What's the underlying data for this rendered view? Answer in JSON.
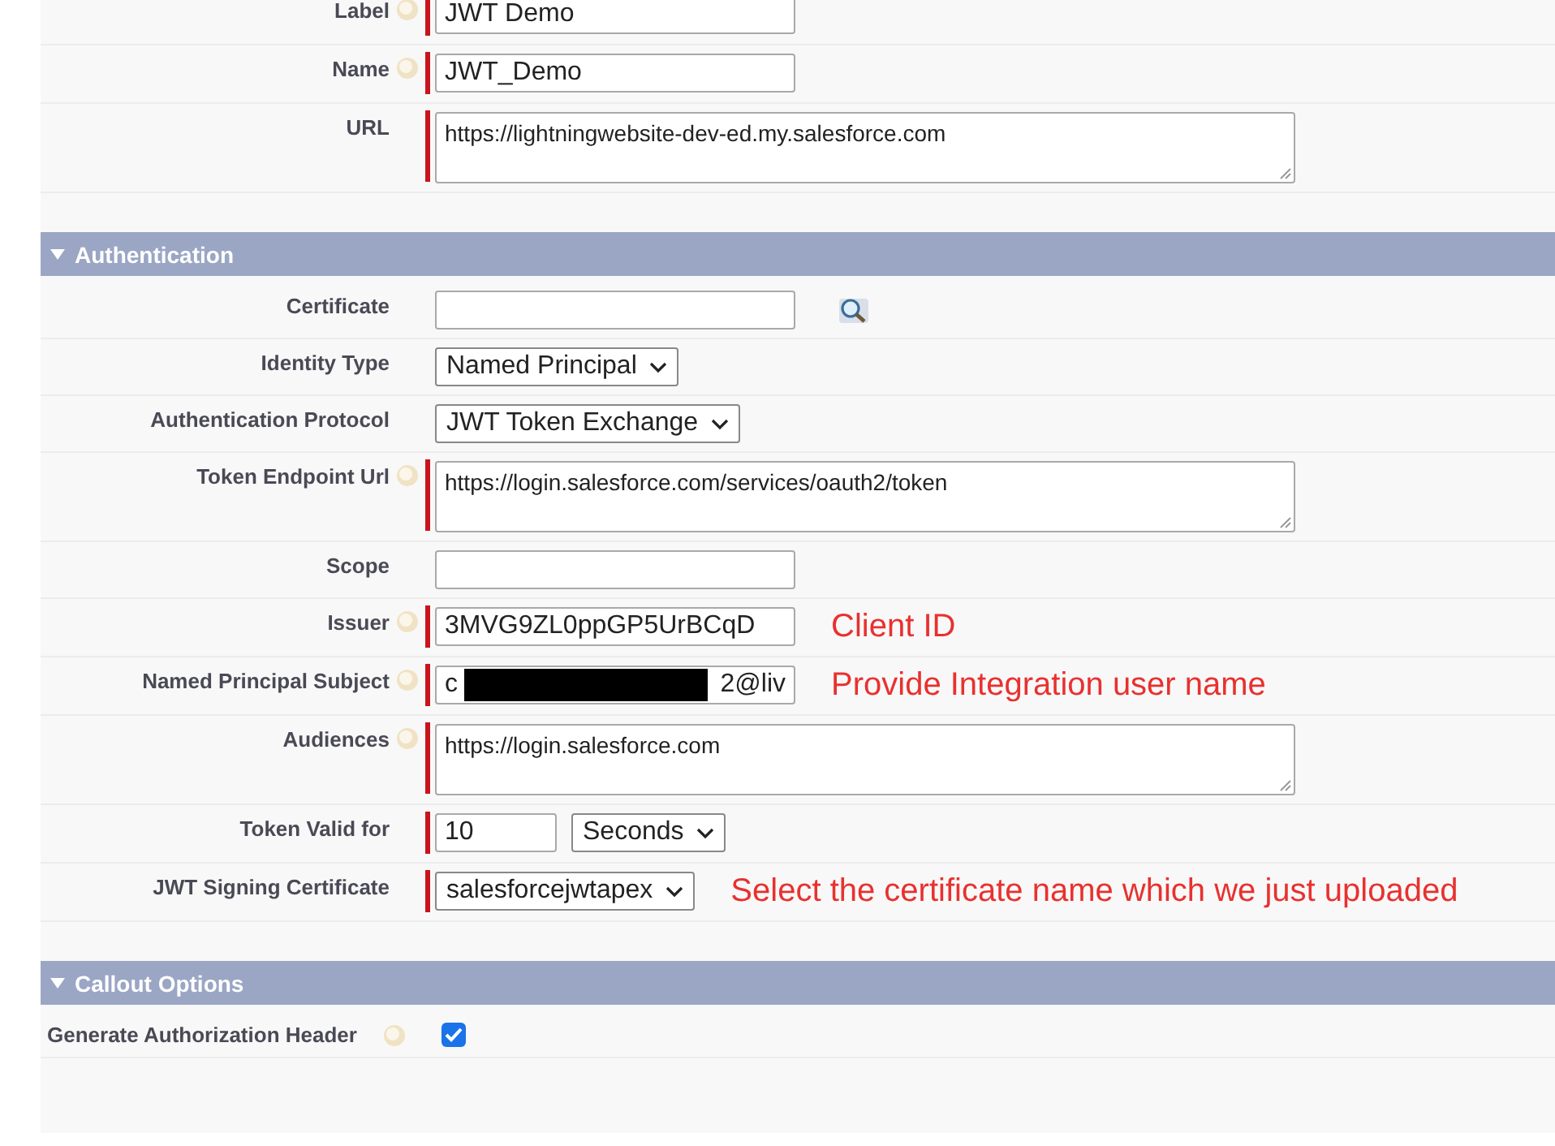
{
  "sections": [
    {
      "rows": [
        {
          "kind": "text",
          "label": "Label",
          "help": true,
          "required": true,
          "value": "JWT Demo"
        },
        {
          "kind": "text",
          "label": "Name",
          "help": true,
          "required": true,
          "value": "JWT_Demo"
        },
        {
          "kind": "textarea",
          "label": "URL",
          "help": false,
          "required": true,
          "value": "https://lightningwebsite-dev-ed.my.salesforce.com"
        }
      ]
    },
    {
      "title": "Authentication",
      "expanded": true,
      "rows": [
        {
          "kind": "lookup",
          "label": "Certificate",
          "help": false,
          "required": false,
          "value": ""
        },
        {
          "kind": "select",
          "label": "Identity Type",
          "help": false,
          "required": false,
          "value": "Named Principal"
        },
        {
          "kind": "select",
          "label": "Authentication Protocol",
          "help": false,
          "required": false,
          "value": "JWT Token Exchange"
        },
        {
          "kind": "textarea",
          "label": "Token Endpoint Url",
          "help": true,
          "required": true,
          "value": "https://login.salesforce.com/services/oauth2/token"
        },
        {
          "kind": "text",
          "label": "Scope",
          "help": false,
          "required": false,
          "value": ""
        },
        {
          "kind": "text",
          "label": "Issuer",
          "help": true,
          "required": true,
          "value": "3MVG9ZL0ppGP5UrBCqD",
          "note": "Client ID"
        },
        {
          "kind": "redacted",
          "label": "Named Principal Subject",
          "help": true,
          "required": true,
          "value_parts": [
            "c",
            "2@liv"
          ],
          "note": "Provide Integration user name"
        },
        {
          "kind": "textarea",
          "label": "Audiences",
          "help": true,
          "required": true,
          "value": "https://login.salesforce.com"
        },
        {
          "kind": "number_unit",
          "label": "Token Valid for",
          "help": false,
          "required": true,
          "value": "10",
          "unit": "Seconds"
        },
        {
          "kind": "select",
          "label": "JWT Signing Certificate",
          "help": false,
          "required": true,
          "value": "salesforcejwtapex",
          "note": "Select the certificate name which we just uploaded"
        }
      ]
    },
    {
      "title": "Callout Options",
      "expanded": true,
      "rows": [
        {
          "kind": "checkbox",
          "label": "Generate Authorization Header",
          "help": true,
          "checked": true
        }
      ]
    }
  ]
}
